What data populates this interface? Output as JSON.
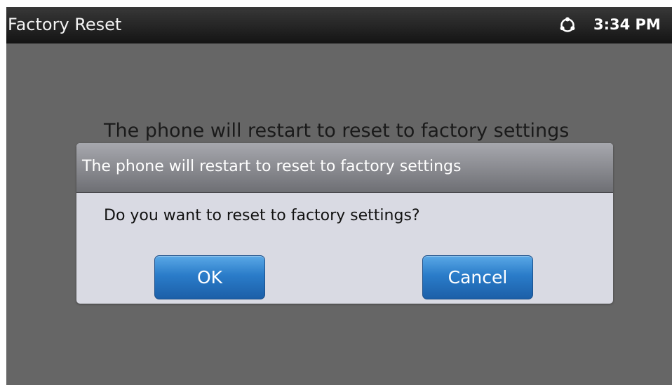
{
  "status_bar": {
    "title": "Factory Reset",
    "time": "3:34 PM",
    "status_icon": "sync-icon"
  },
  "background_message": "The phone will restart to reset to factory settings",
  "dialog": {
    "title": "The phone will restart to reset to factory settings",
    "message": "Do you want to reset to factory settings?",
    "ok_label": "OK",
    "cancel_label": "Cancel"
  },
  "colors": {
    "screen_background": "#666666",
    "dialog_background": "#d9dae3",
    "button_blue": "#2a7cc9"
  }
}
